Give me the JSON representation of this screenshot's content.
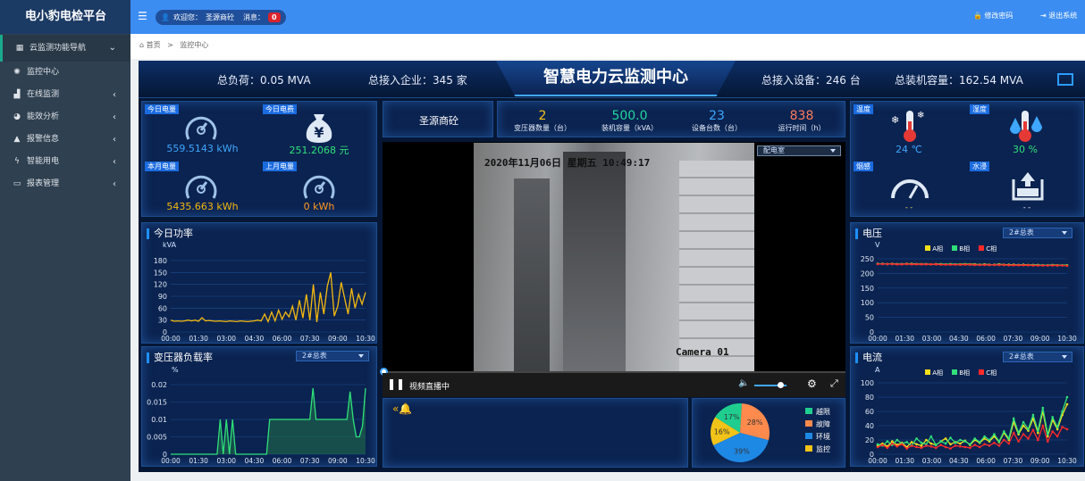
{
  "app": {
    "brand": "电小豹电检平台"
  },
  "sidebar": {
    "items": [
      {
        "label": "云监测功能导航",
        "icon": "grid-icon",
        "caret": "⌄"
      },
      {
        "label": "监控中心",
        "icon": "dashboard-icon",
        "caret": ""
      },
      {
        "label": "在线监测",
        "icon": "chart-area-icon",
        "caret": "‹"
      },
      {
        "label": "能效分析",
        "icon": "pie-icon",
        "caret": "‹"
      },
      {
        "label": "报警信息",
        "icon": "warning-icon",
        "caret": "‹"
      },
      {
        "label": "智能用电",
        "icon": "bolt-icon",
        "caret": "‹"
      },
      {
        "label": "报表管理",
        "icon": "table-icon",
        "caret": "‹"
      }
    ]
  },
  "topbar": {
    "welcome": "欢迎您：",
    "user": "圣源商砼",
    "msg_label": "消息：",
    "msg_count": "0",
    "change_pwd": "修改密码",
    "logout": "退出系统"
  },
  "breadcrumb": {
    "home": "首页",
    "sep": ">",
    "current": "监控中心"
  },
  "header": {
    "title": "智慧电力云监测中心",
    "total_load": "总负荷：0.05 MVA",
    "total_companies": "总接入企业：345 家",
    "total_devices": "总接入设备：246 台",
    "total_capacity": "总装机容量：162.54 MVA"
  },
  "energy": {
    "today": {
      "tag": "今日电量",
      "value": "559.5143 kWh",
      "color": "#3fa7ff"
    },
    "today_fee": {
      "tag": "今日电费",
      "value": "251.2068 元",
      "color": "#2fe07a"
    },
    "month": {
      "tag": "本月电量",
      "value": "5435.663 kWh",
      "color": "#f5b90f"
    },
    "last_month": {
      "tag": "上月电量",
      "value": "0 kWh",
      "color": "#ff9a1f"
    }
  },
  "company": {
    "name": "圣源商砼"
  },
  "stats": [
    {
      "value": "2",
      "label": "变压器数量（台）",
      "color": "#f5c518"
    },
    {
      "value": "500.0",
      "label": "装机容量（kVA）",
      "color": "#22d6a0"
    },
    {
      "value": "23",
      "label": "设备台数（台）",
      "color": "#3fa7ff"
    },
    {
      "value": "838",
      "label": "运行时间（h）",
      "color": "#ff7b5c"
    }
  ],
  "video": {
    "room": "配电室",
    "timestamp": "2020年11月06日 星期五 10:49:17",
    "camera": "Camera 01",
    "status": "视频直播中"
  },
  "env": {
    "temp": {
      "tag": "温度",
      "value": "24 ℃",
      "color": "#3fa7ff"
    },
    "humidity": {
      "tag": "湿度",
      "value": "30 %",
      "color": "#2fe07a"
    },
    "smoke": {
      "tag": "烟感",
      "value": "- -"
    },
    "water": {
      "tag": "水浸",
      "value": "- -"
    }
  },
  "power_chart": {
    "title": "今日功率",
    "unit": "kVA"
  },
  "load_chart": {
    "title": "变压器负载率",
    "unit": "%",
    "select": "2#总表"
  },
  "voltage_chart": {
    "title": "电压",
    "unit": "V",
    "select": "2#总表",
    "legend": [
      "A相",
      "B相",
      "C相"
    ]
  },
  "current_chart": {
    "title": "电流",
    "unit": "A",
    "select": "2#总表",
    "legend": [
      "A相",
      "B相",
      "C相"
    ]
  },
  "alarm": {
    "pie": [
      {
        "name": "越限",
        "value": 17,
        "label": "17%",
        "color": "#1fce8f"
      },
      {
        "name": "故障",
        "value": 28,
        "label": "28%",
        "color": "#ff8a4d"
      },
      {
        "name": "环境",
        "value": 39,
        "label": "39%",
        "color": "#1e88e5"
      },
      {
        "name": "监控",
        "value": 16,
        "label": "16%",
        "color": "#f2c318"
      }
    ]
  },
  "chart_data": [
    {
      "type": "line",
      "title": "今日功率",
      "ylabel": "kVA",
      "ylim": [
        0,
        180
      ],
      "yticks": [
        0,
        30,
        60,
        90,
        120,
        150,
        180
      ],
      "categories": [
        "00:00",
        "01:30",
        "03:00",
        "04:30",
        "06:00",
        "07:30",
        "09:00",
        "10:30"
      ],
      "series": [
        {
          "color": "#f5b90f",
          "values": [
            30,
            27,
            28,
            27,
            28,
            30,
            28,
            30,
            27,
            36,
            28,
            29,
            28,
            27,
            28,
            27,
            26,
            28,
            27,
            26,
            28,
            27,
            26,
            27,
            28,
            30,
            28,
            45,
            26,
            50,
            28,
            55,
            32,
            50,
            38,
            65,
            30,
            80,
            35,
            95,
            30,
            120,
            25,
            100,
            45,
            115,
            150,
            40,
            65,
            125,
            85,
            45,
            110,
            60,
            95,
            70,
            100
          ]
        }
      ]
    },
    {
      "type": "area",
      "title": "变压器负载率",
      "ylabel": "%",
      "ylim": [
        0,
        0.02
      ],
      "yticks": [
        0,
        0.005,
        0.01,
        0.015,
        0.02
      ],
      "categories": [
        "00:00",
        "01:30",
        "03:00",
        "04:30",
        "06:00",
        "07:30",
        "09:00",
        "10:30"
      ],
      "series": [
        {
          "color": "#2fe07a",
          "values": [
            0,
            0,
            0,
            0,
            0,
            0,
            0,
            0,
            0,
            0,
            0,
            0,
            0,
            0,
            0,
            0,
            0.01,
            0,
            0.01,
            0,
            0.01,
            0,
            0,
            0,
            0,
            0,
            0,
            0,
            0,
            0,
            0,
            0,
            0.01,
            0.01,
            0.01,
            0.01,
            0.01,
            0.01,
            0.01,
            0.01,
            0.01,
            0.01,
            0.01,
            0.01,
            0.01,
            0.01,
            0.019,
            0.01,
            0.01,
            0.01,
            0.01,
            0.01,
            0.01,
            0.01,
            0.01,
            0.01,
            0.01,
            0.01,
            0.018,
            0.01,
            0.005,
            0.005,
            0.008,
            0.019
          ]
        }
      ]
    },
    {
      "type": "line",
      "title": "电压",
      "ylabel": "V",
      "ylim": [
        0,
        250
      ],
      "yticks": [
        0,
        50,
        100,
        150,
        200,
        250
      ],
      "categories": [
        "00:00",
        "01:30",
        "03:00",
        "04:30",
        "06:00",
        "07:30",
        "09:00",
        "10:30"
      ],
      "series": [
        {
          "name": "A相",
          "color": "#f5e11a",
          "values": [
            233,
            233,
            232,
            233,
            232,
            232,
            233,
            233,
            232,
            232,
            232,
            231,
            232,
            232,
            231,
            232,
            231,
            231,
            232,
            231,
            231,
            230,
            231,
            230,
            230,
            231,
            230,
            230,
            230,
            229,
            230,
            229,
            229,
            229,
            228,
            228,
            229,
            228,
            228,
            228
          ]
        },
        {
          "name": "B相",
          "color": "#2fe07a",
          "values": [
            233,
            233,
            232,
            232,
            232,
            232,
            232,
            232,
            232,
            231,
            232,
            231,
            231,
            231,
            231,
            231,
            231,
            230,
            231,
            230,
            230,
            230,
            230,
            229,
            230,
            230,
            229,
            229,
            229,
            229,
            229,
            228,
            228,
            228,
            228,
            228,
            228,
            227,
            228,
            227
          ]
        },
        {
          "name": "C相",
          "color": "#ff2a2a",
          "values": [
            232,
            232,
            232,
            232,
            231,
            231,
            232,
            231,
            231,
            231,
            231,
            231,
            231,
            230,
            230,
            230,
            230,
            230,
            230,
            230,
            229,
            229,
            229,
            229,
            229,
            229,
            229,
            228,
            228,
            228,
            228,
            228,
            227,
            227,
            227,
            227,
            227,
            227,
            227,
            226
          ]
        }
      ]
    },
    {
      "type": "line",
      "title": "电流",
      "ylabel": "A",
      "ylim": [
        0,
        100
      ],
      "yticks": [
        0,
        20,
        40,
        60,
        80,
        100
      ],
      "categories": [
        "00:00",
        "01:30",
        "03:00",
        "04:30",
        "06:00",
        "07:30",
        "09:00",
        "10:30"
      ],
      "series": [
        {
          "name": "A相",
          "color": "#f5e11a",
          "values": [
            12,
            15,
            11,
            18,
            13,
            16,
            10,
            17,
            14,
            12,
            20,
            15,
            13,
            18,
            22,
            14,
            17,
            15,
            19,
            13,
            20,
            16,
            22,
            18,
            25,
            17,
            30,
            20,
            45,
            28,
            40,
            33,
            50,
            30,
            60,
            25,
            48,
            35,
            55,
            70
          ]
        },
        {
          "name": "B相",
          "color": "#2fe07a",
          "values": [
            14,
            12,
            18,
            13,
            20,
            15,
            17,
            12,
            22,
            16,
            14,
            25,
            13,
            18,
            15,
            23,
            16,
            20,
            18,
            14,
            22,
            17,
            25,
            20,
            28,
            18,
            32,
            22,
            50,
            30,
            45,
            35,
            55,
            33,
            65,
            28,
            52,
            38,
            60,
            80
          ]
        },
        {
          "name": "C相",
          "color": "#ff2a2a",
          "values": [
            10,
            13,
            9,
            15,
            11,
            14,
            8,
            12,
            10,
            9,
            12,
            11,
            9,
            13,
            10,
            8,
            12,
            11,
            10,
            9,
            13,
            10,
            14,
            12,
            16,
            12,
            20,
            15,
            30,
            18,
            28,
            22,
            34,
            20,
            40,
            18,
            32,
            25,
            38,
            35
          ]
        }
      ]
    },
    {
      "type": "pie",
      "title": "",
      "categories": [
        "越限",
        "故障",
        "环境",
        "监控"
      ],
      "values": [
        17,
        28,
        39,
        16
      ]
    }
  ]
}
